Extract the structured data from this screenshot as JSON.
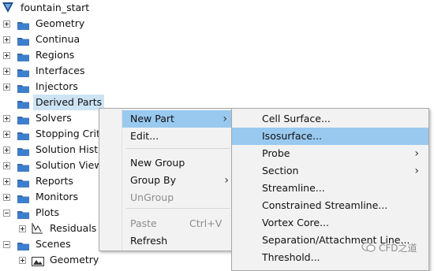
{
  "root": {
    "label": "fountain_start"
  },
  "tree": [
    {
      "label": "Geometry",
      "expander": "plus"
    },
    {
      "label": "Continua",
      "expander": "plus"
    },
    {
      "label": "Regions",
      "expander": "plus"
    },
    {
      "label": "Interfaces",
      "expander": "plus"
    },
    {
      "label": "Injectors",
      "expander": "plus"
    },
    {
      "label": "Derived Parts",
      "expander": "none"
    },
    {
      "label": "Solvers",
      "expander": "plus"
    },
    {
      "label": "Stopping Crit",
      "expander": "plus"
    },
    {
      "label": "Solution Hist",
      "expander": "plus"
    },
    {
      "label": "Solution View",
      "expander": "plus"
    },
    {
      "label": "Reports",
      "expander": "plus"
    },
    {
      "label": "Monitors",
      "expander": "plus"
    },
    {
      "label": "Plots",
      "expander": "minus"
    },
    {
      "label": "Residuals",
      "expander": "plus"
    },
    {
      "label": "Scenes",
      "expander": "minus"
    },
    {
      "label": "Geometry",
      "expander": "plus"
    }
  ],
  "context_menu": {
    "items": [
      {
        "label": "New Part",
        "shortcut": "",
        "submenu": true,
        "highlighted": true,
        "disabled": false
      },
      {
        "label": "Edit...",
        "shortcut": "",
        "submenu": false,
        "highlighted": false,
        "disabled": false
      },
      {
        "label": "New Group",
        "shortcut": "",
        "submenu": false,
        "highlighted": false,
        "disabled": false
      },
      {
        "label": "Group By",
        "shortcut": "",
        "submenu": true,
        "highlighted": false,
        "disabled": false
      },
      {
        "label": "UnGroup",
        "shortcut": "",
        "submenu": false,
        "highlighted": false,
        "disabled": true
      },
      {
        "label": "Paste",
        "shortcut": "Ctrl+V",
        "submenu": false,
        "highlighted": false,
        "disabled": true
      },
      {
        "label": "Refresh",
        "shortcut": "",
        "submenu": false,
        "highlighted": false,
        "disabled": false
      }
    ]
  },
  "submenu": {
    "items": [
      {
        "label": "Cell Surface...",
        "submenu": false,
        "highlighted": false
      },
      {
        "label": "Isosurface...",
        "submenu": false,
        "highlighted": true
      },
      {
        "label": "Probe",
        "submenu": true,
        "highlighted": false
      },
      {
        "label": "Section",
        "submenu": true,
        "highlighted": false
      },
      {
        "label": "Streamline...",
        "submenu": false,
        "highlighted": false
      },
      {
        "label": "Constrained Streamline...",
        "submenu": false,
        "highlighted": false
      },
      {
        "label": "Vortex Core...",
        "submenu": false,
        "highlighted": false
      },
      {
        "label": "Separation/Attachment Line...",
        "submenu": false,
        "highlighted": false
      },
      {
        "label": "Threshold...",
        "submenu": false,
        "highlighted": false
      }
    ]
  },
  "watermark": {
    "text": "CFD之道"
  },
  "colors": {
    "menu_highlight": "#99c9ef",
    "selected_node": "#cde4f5",
    "folder_blue": "#2f6db5"
  }
}
